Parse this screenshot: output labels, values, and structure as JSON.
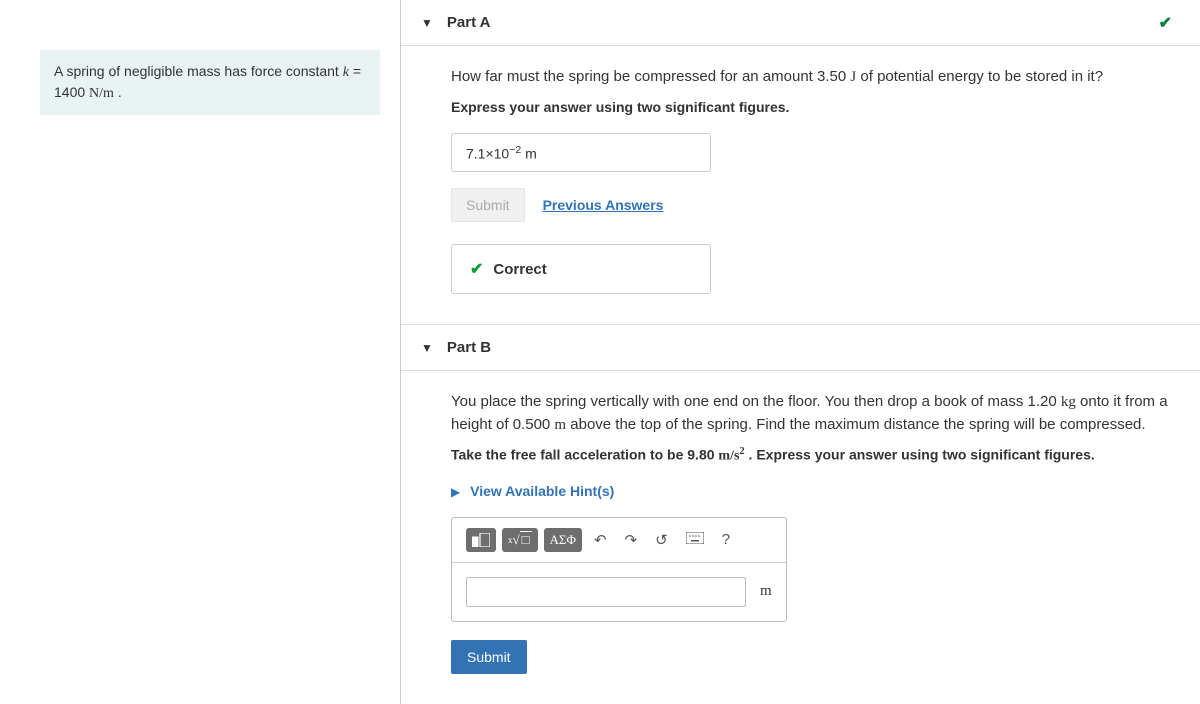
{
  "problem": {
    "text_1": "A spring of negligible mass has force constant ",
    "var_k": "k",
    "equals": " = 1400 ",
    "unit_Nm": "N/m",
    "period": " ."
  },
  "partA": {
    "title": "Part A",
    "question_pre": "How far must the spring be compressed for an amount 3.50 ",
    "unit_J": "J",
    "question_post": " of potential energy to be stored in it?",
    "instruction": "Express your answer using two significant figures.",
    "answer_coeff": "7.1",
    "answer_ten": "×10",
    "answer_exp": "−2",
    "answer_unit": "  m",
    "submit_label": "Submit",
    "prev_label": "Previous Answers",
    "correct_label": "Correct"
  },
  "partB": {
    "title": "Part B",
    "q_l1_pre": "You place the spring vertically with one end on the floor. You then drop a book of mass 1.20 ",
    "unit_kg": "kg",
    "q_l1_mid": " onto it from a height of 0.500 ",
    "unit_m": "m",
    "q_l1_post": " above the top of the spring. Find the maximum distance the spring will be compressed.",
    "instr_pre": "Take the free fall acceleration to be 9.80 ",
    "unit_ms": "m/s",
    "instr_exp": "2",
    "instr_post": " . Express your answer using two significant figures.",
    "hints_label": "View Available Hint(s)",
    "tool_greek": "ΑΣΦ",
    "answer_unit": "m",
    "submit_label": "Submit"
  }
}
